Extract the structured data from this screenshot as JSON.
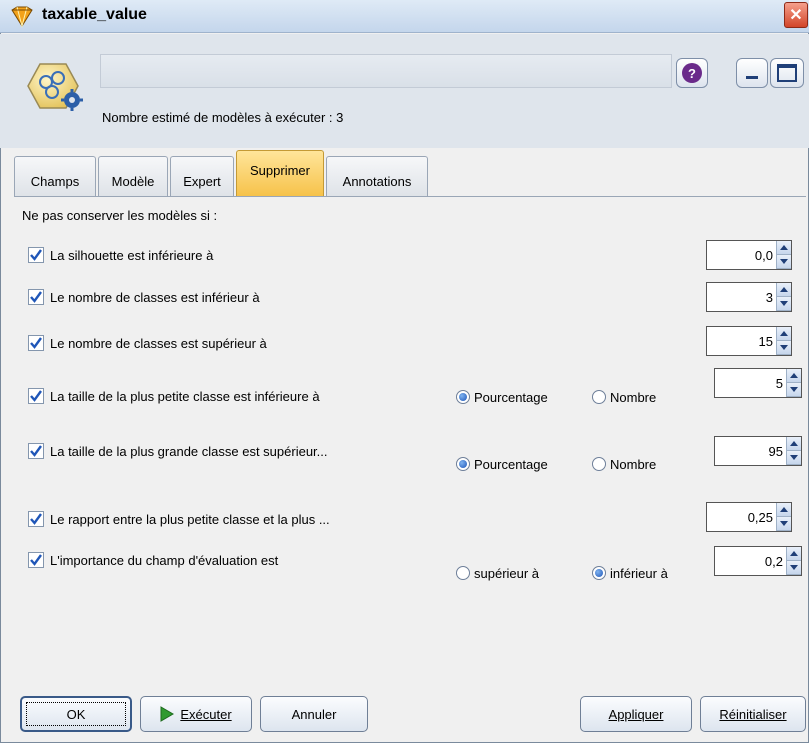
{
  "window": {
    "title": "taxable_value",
    "close_glyph": "✕"
  },
  "header": {
    "subtitle": "Nombre estimé de modèles à exécuter : 3",
    "node_icon": "clustering-node-icon",
    "help_glyph": "?"
  },
  "tabs": [
    {
      "label": "Champs"
    },
    {
      "label": "Modèle"
    },
    {
      "label": "Expert"
    },
    {
      "label": "Supprimer"
    },
    {
      "label": "Annotations"
    }
  ],
  "active_tab": "Supprimer",
  "main": {
    "intro": "Ne pas conserver les modèles si :",
    "rows": [
      {
        "label": "La silhouette est inférieure à",
        "checked": true,
        "value": "0,0"
      },
      {
        "label": "Le nombre de classes est inférieur à",
        "checked": true,
        "value": "3"
      },
      {
        "label": "Le nombre de classes est supérieur à",
        "checked": true,
        "value": "15"
      },
      {
        "label": "La taille de la plus petite classe est inférieure à",
        "checked": true,
        "value": "5",
        "radio_a": "Pourcentage",
        "radio_b": "Nombre",
        "selected": "Pourcentage"
      },
      {
        "label": "La taille de la plus grande classe est supérieur...",
        "checked": true,
        "value": "95",
        "radio_a": "Pourcentage",
        "radio_b": "Nombre",
        "selected": "Pourcentage"
      },
      {
        "label": "Le rapport entre la plus petite classe et la plus ...",
        "checked": true,
        "value": "0,25"
      },
      {
        "label": "L'importance du champ d'évaluation est",
        "checked": true,
        "value": "0,2",
        "radio_a": "supérieur à",
        "radio_b": "inférieur à",
        "selected": "inférieur à"
      }
    ]
  },
  "buttons": {
    "ok": "OK",
    "execute": "Exécuter",
    "cancel": "Annuler",
    "apply": "Appliquer",
    "reset": "Réinitialiser"
  },
  "colors": {
    "active_tab": "#f6c24a",
    "checkmark": "#1f56b8",
    "run_arrow": "#2f9a2f"
  }
}
